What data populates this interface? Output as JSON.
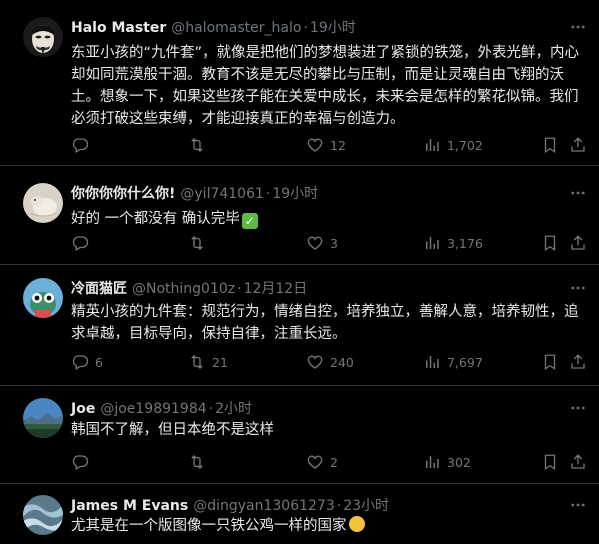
{
  "tweets": [
    {
      "name": "Halo Master",
      "handle": "@halomaster_halo",
      "dot": "·",
      "time": "19小时",
      "text": "东亚小孩的“九件套”，就像是把他们的梦想装进了紧锁的铁笼，外表光鲜，内心却如同荒漠般干涸。教育不该是无尽的攀比与压制，而是让灵魂自由飞翔的沃土。想象一下，如果这些孩子能在关爱中成长，未来会是怎样的繁花似锦。我们必须打破这些束缚，才能迎接真正的幸福与创造力。",
      "reply": "",
      "repost": "",
      "like": "12",
      "views": "1,702"
    },
    {
      "name": "你你你你什么你!",
      "handle": "@yil741061",
      "dot": "·",
      "time": "19小时",
      "text": "好的  一个都没有  确认完毕",
      "emoji": "✓",
      "reply": "",
      "repost": "",
      "like": "3",
      "views": "3,176"
    },
    {
      "name": "冷面猫匠",
      "handle": "@Nothing010z",
      "dot": "·",
      "time": "12月12日",
      "text": "精英小孩的九件套：规范行为，情绪自控，培养独立，善解人意，培养韧性，追求卓越，目标导向，保持自律，注重长远。",
      "reply": "6",
      "repost": "21",
      "like": "240",
      "views": "7,697"
    },
    {
      "name": "Joe",
      "handle": "@joe19891984",
      "dot": "·",
      "time": "2小时",
      "text": "韩国不了解，但日本绝不是这样",
      "reply": "",
      "repost": "",
      "like": "2",
      "views": "302"
    },
    {
      "name": "James M Evans",
      "handle": "@dingyan13061273",
      "dot": "·",
      "time": "23小时",
      "text": "尤其是在一个版图像一只铁公鸡一样的国家",
      "reply": "",
      "repost": "",
      "like": "",
      "views": ""
    }
  ],
  "colors": {
    "background": "#000000",
    "text": "#e7e9ea",
    "secondary": "#71767b",
    "divider": "#2f3336"
  },
  "icons": [
    "more-icon",
    "reply-icon",
    "repost-icon",
    "like-icon",
    "views-icon",
    "bookmark-icon",
    "share-icon"
  ]
}
